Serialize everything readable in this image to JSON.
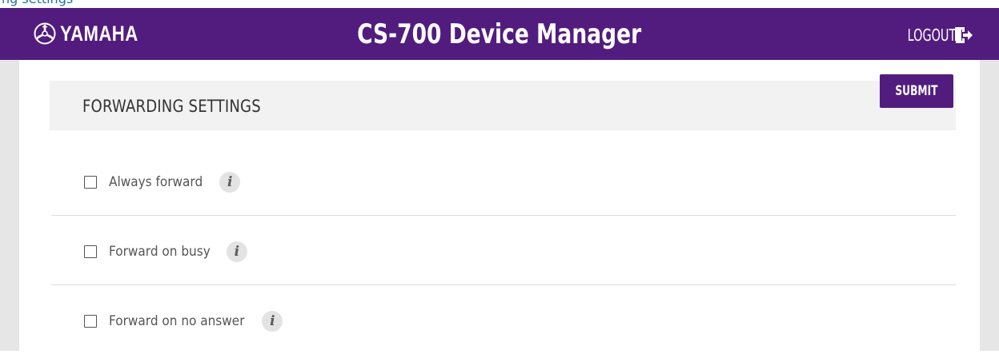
{
  "page": {
    "top_strip_text": "ng settings"
  },
  "header": {
    "brand": "YAMAHA",
    "title": "CS-700 Device Manager",
    "logout_label": "LOGOUT"
  },
  "toolbar": {
    "submit_label": "SUBMIT"
  },
  "section": {
    "title": "FORWARDING SETTINGS",
    "options": [
      {
        "label": "Always forward",
        "checked": false
      },
      {
        "label": "Forward on busy",
        "checked": false
      },
      {
        "label": "Forward on no answer",
        "checked": false
      }
    ],
    "info_icon_glyph": "i"
  },
  "colors": {
    "header_bg": "#521c7f",
    "page_bg": "#e6e6e6",
    "section_header_bg": "#f2f2f2",
    "top_strip_text": "#1f6fb5"
  },
  "icons": [
    "yamaha-logo-icon",
    "logout-icon",
    "checkbox-icon",
    "info-icon"
  ]
}
